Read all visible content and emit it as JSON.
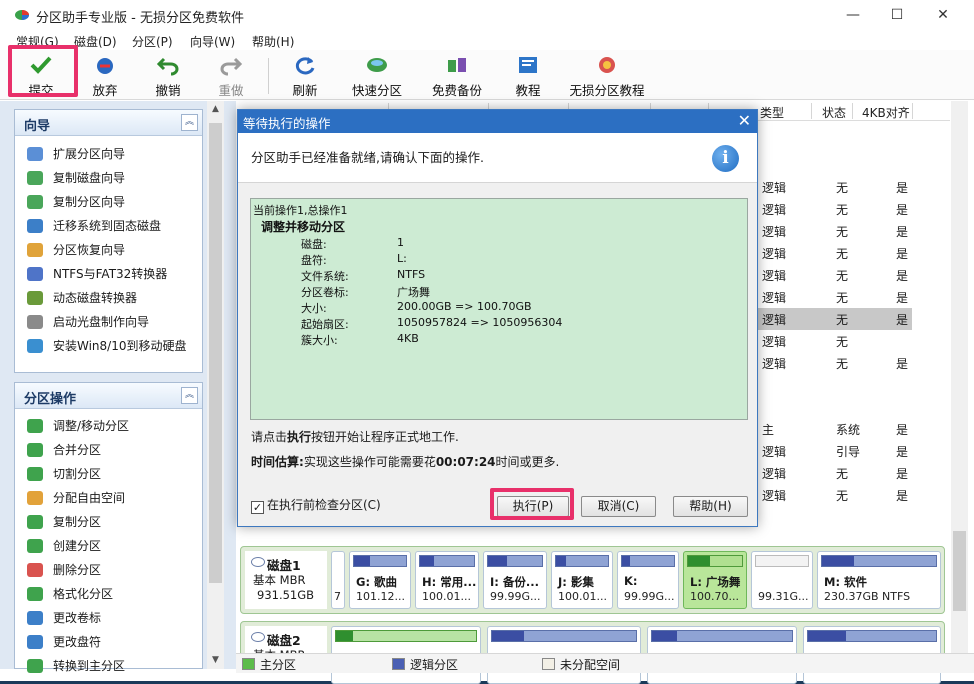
{
  "window": {
    "title": "分区助手专业版 - 无损分区免费软件",
    "controls": {
      "minimize": "—",
      "maximize": "☐",
      "close": "✕"
    }
  },
  "menu": {
    "items": [
      "常规(G)",
      "磁盘(D)",
      "分区(P)",
      "向导(W)",
      "帮助(H)"
    ]
  },
  "toolbar": {
    "submit": "提交",
    "discard": "放弃",
    "undo": "撤销",
    "redo": "重做",
    "refresh": "刷新",
    "quick_partition": "快速分区",
    "free_backup": "免费备份",
    "tutorial": "教程",
    "lossless_tutorial": "无损分区教程"
  },
  "wizard_panel": {
    "title": "向导",
    "items": [
      "扩展分区向导",
      "复制磁盘向导",
      "复制分区向导",
      "迁移系统到固态磁盘",
      "分区恢复向导",
      "NTFS与FAT32转换器",
      "动态磁盘转换器",
      "启动光盘制作向导",
      "安装Win8/10到移动硬盘"
    ]
  },
  "partition_panel": {
    "title": "分区操作",
    "items": [
      "调整/移动分区",
      "合并分区",
      "切割分区",
      "分配自由空间",
      "复制分区",
      "创建分区",
      "删除分区",
      "格式化分区",
      "更改卷标",
      "更改盘符",
      "转换到主分区"
    ]
  },
  "grid": {
    "headers": {
      "type": "类型",
      "status": "状态",
      "align4k": "4KB对齐"
    },
    "rows": [
      {
        "type": "逻辑",
        "status": "无",
        "align4k": "是"
      },
      {
        "type": "逻辑",
        "status": "无",
        "align4k": "是"
      },
      {
        "type": "逻辑",
        "status": "无",
        "align4k": "是"
      },
      {
        "type": "逻辑",
        "status": "无",
        "align4k": "是"
      },
      {
        "type": "逻辑",
        "status": "无",
        "align4k": "是"
      },
      {
        "type": "逻辑",
        "status": "无",
        "align4k": "是"
      },
      {
        "type": "逻辑",
        "status": "无",
        "align4k": "是"
      },
      {
        "type": "逻辑",
        "status": "无",
        "align4k": "是"
      },
      {
        "type": "逻辑",
        "status": "无",
        "align4k": "是"
      },
      {
        "type": "逻辑",
        "status": "无",
        "align4k": ""
      },
      {
        "type": "逻辑",
        "status": "无",
        "align4k": "是"
      },
      {
        "type": "主",
        "status": "系统",
        "align4k": "是"
      },
      {
        "type": "逻辑",
        "status": "引导",
        "align4k": "是"
      },
      {
        "type": "逻辑",
        "status": "无",
        "align4k": "是"
      },
      {
        "type": "逻辑",
        "status": "无",
        "align4k": "是"
      }
    ]
  },
  "dialog": {
    "title": "等待执行的操作",
    "close": "✕",
    "message": "分区助手已经准备就绪,请确认下面的操作.",
    "info_icon": "i",
    "ops_line1": "当前操作1,总操作1",
    "ops_line2": "调整并移动分区",
    "details": [
      {
        "k": "磁盘:",
        "v": "1"
      },
      {
        "k": "盘符:",
        "v": "L:"
      },
      {
        "k": "文件系统:",
        "v": "NTFS"
      },
      {
        "k": "分区卷标:",
        "v": "广场舞"
      },
      {
        "k": "大小:",
        "v": "200.00GB => 100.70GB"
      },
      {
        "k": "起始扇区:",
        "v": "1050957824 => 1050956304"
      },
      {
        "k": "簇大小:",
        "v": "4KB"
      }
    ],
    "note_prefix": "请点击",
    "note_bold": "执行",
    "note_suffix": "按钮开始让程序正式地工作.",
    "time_label": "时间估算:",
    "time_prefix": "实现这些操作可能需要花",
    "time_value": "00:07:24",
    "time_suffix": "时间或更多.",
    "check_label": "在执行前检查分区(C)",
    "check_mark": "✓",
    "execute": "执行(P)",
    "cancel": "取消(C)",
    "help": "帮助(H)"
  },
  "disk1": {
    "name": "磁盘1",
    "type": "基本 MBR",
    "size": "931.51GB",
    "partitions": [
      {
        "label": "",
        "size": "7"
      },
      {
        "label": "G: 歌曲",
        "size": "101.12..."
      },
      {
        "label": "H: 常用...",
        "size": "100.01..."
      },
      {
        "label": "I: 备份...",
        "size": "99.99G..."
      },
      {
        "label": "J: 影集",
        "size": "100.01..."
      },
      {
        "label": "K:",
        "size": "99.99G..."
      },
      {
        "label": "L: 广场舞",
        "size": "100.70..."
      },
      {
        "label": "",
        "size": "99.31G..."
      },
      {
        "label": "M: 软件",
        "size": "230.37GB NTFS"
      }
    ]
  },
  "disk2": {
    "name": "磁盘2",
    "type": "基本 MBR"
  },
  "legend": {
    "primary": "主分区",
    "logical": "逻辑分区",
    "unallocated": "未分配空间"
  },
  "colors": {
    "highlight": "#e8306a",
    "dialog_title": "#2c6fc2",
    "ops_bg": "#cdebd3",
    "selected_partition": "#b9e69a"
  }
}
